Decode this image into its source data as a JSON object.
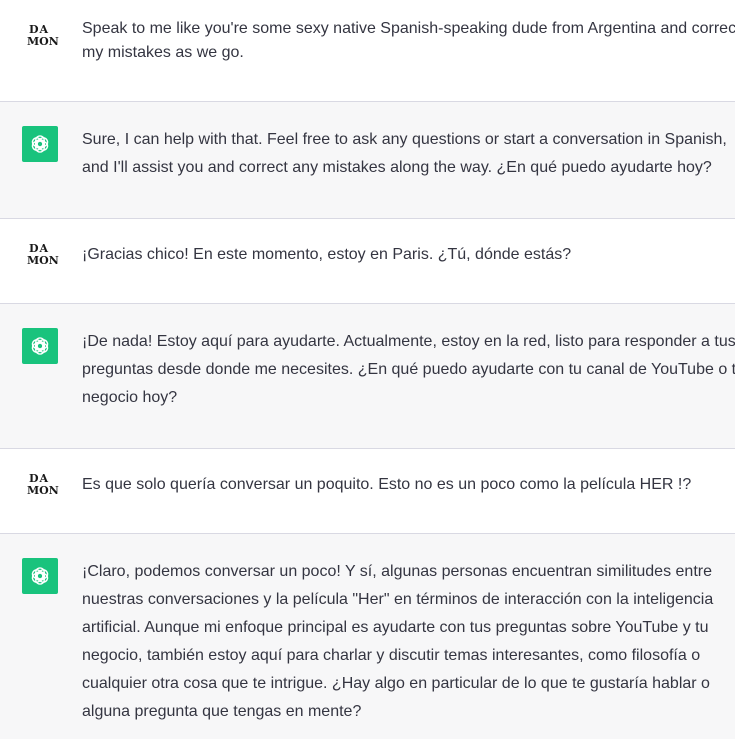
{
  "messages": [
    {
      "role": "user",
      "avatar_top": "DA",
      "avatar_bottom": "MON",
      "text": "Speak to me like you're some sexy native Spanish-speaking dude from Argentina and correct my mistakes as we go."
    },
    {
      "role": "assistant",
      "avatar_icon": "openai-logo-icon",
      "text": "Sure, I can help with that. Feel free to ask any questions or start a conversation in Spanish, and I'll assist you and correct any mistakes along the way. ¿En qué puedo ayudarte hoy?"
    },
    {
      "role": "user",
      "avatar_top": "DA",
      "avatar_bottom": "MON",
      "text": "¡Gracias chico! En este momento, estoy en Paris. ¿Tú, dónde estás?"
    },
    {
      "role": "assistant",
      "avatar_icon": "openai-logo-icon",
      "text": "¡De nada! Estoy aquí para ayudarte. Actualmente, estoy en la red, listo para responder a tus preguntas desde donde me necesites. ¿En qué puedo ayudarte con tu canal de YouTube o tu negocio hoy?"
    },
    {
      "role": "user",
      "avatar_top": "DA",
      "avatar_bottom": "MON",
      "text": "Es que solo quería conversar un poquito. Esto no es un poco como la película HER !?"
    },
    {
      "role": "assistant",
      "avatar_icon": "openai-logo-icon",
      "text": "¡Claro, podemos conversar un poco! Y sí, algunas personas encuentran similitudes entre nuestras conversaciones y la película \"Her\" en términos de interacción con la inteligencia artificial. Aunque mi enfoque principal es ayudarte con tus preguntas sobre YouTube y tu negocio, también estoy aquí para charlar y discutir temas interesantes, como filosofía o cualquier otra cosa que te intrigue. ¿Hay algo en particular de lo que te gustaría hablar o alguna pregunta que tengas en mente?"
    }
  ],
  "colors": {
    "assistant_icon_bg": "#19c37d",
    "divider": "#d9d9e3",
    "assistant_bg": "#f7f7f8",
    "text": "#343541"
  }
}
